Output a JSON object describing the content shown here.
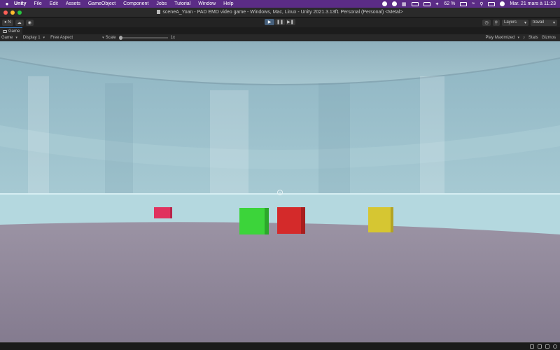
{
  "menubar": {
    "app_name": "Unity",
    "items": [
      "File",
      "Edit",
      "Assets",
      "GameObject",
      "Component",
      "Jobs",
      "Tutorial",
      "Window",
      "Help"
    ],
    "battery": "62 %",
    "datetime": "Mar. 21 mars à  11:23"
  },
  "window": {
    "title": "sceneA_Yoan - PAD EMD video game - Windows, Mac, Linux - Unity 2021.3.13f1 Personal (Personal) <Metal>"
  },
  "toolbar": {
    "account_label": "N",
    "layers_label": "Layers",
    "layout_label": "travail"
  },
  "tab": {
    "label": "Game"
  },
  "gamebar": {
    "mode": "Game",
    "display": "Display 1",
    "aspect": "Free Aspect",
    "scale_label": "Scale",
    "scale_value": "1x",
    "play_mode": "Play Maximized",
    "stats_label": "Stats",
    "gizmos_label": "Gizmos"
  },
  "scene": {
    "sky_color": "#9fc4cf",
    "floor_color": "#8a8295",
    "cubes": [
      {
        "name": "pink-cube",
        "color": "#e0325e"
      },
      {
        "name": "green-cube",
        "color": "#3cd43a"
      },
      {
        "name": "red-cube",
        "color": "#d42a2a"
      },
      {
        "name": "yellow-cube",
        "color": "#d6c632"
      }
    ]
  }
}
